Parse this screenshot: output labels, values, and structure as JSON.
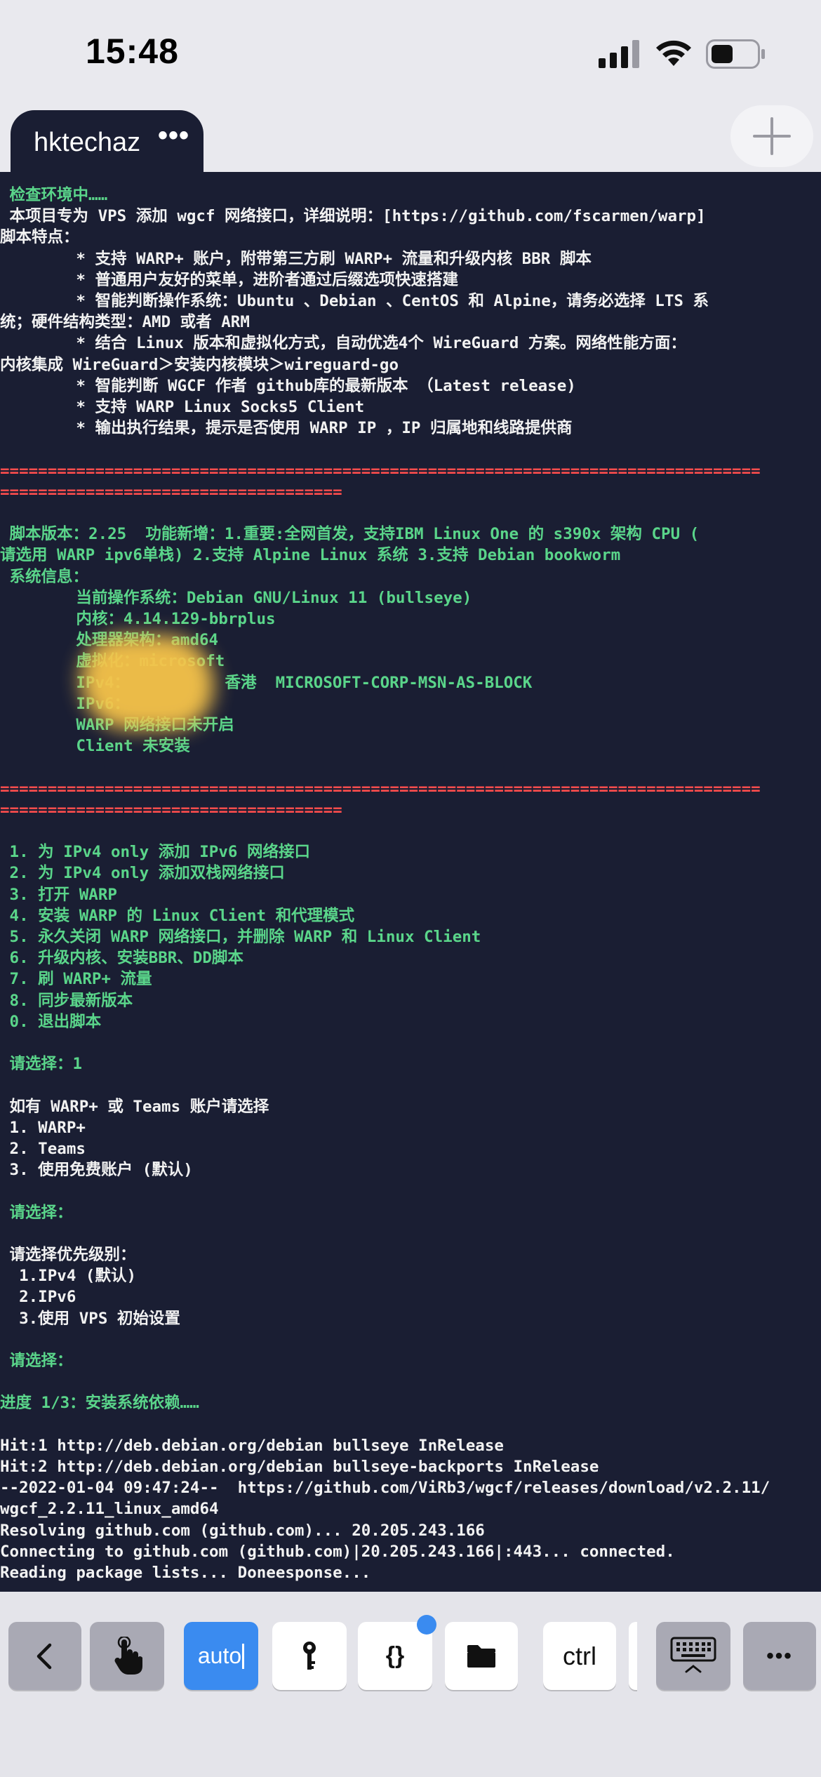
{
  "status_bar": {
    "time": "15:48",
    "icons": [
      "cellular-signal-icon",
      "wifi-icon",
      "battery-icon"
    ]
  },
  "tab": {
    "title": "hktechaz",
    "more_label": "•••",
    "add_tab_icon": "plus-icon"
  },
  "terminal": {
    "colors": {
      "background": "#1a1e33",
      "green": "#5ad58a",
      "white": "#f2f2f2",
      "red": "#ff4d4d"
    },
    "lines": [
      {
        "text": " 检查环境中……",
        "color": "g"
      },
      {
        "text": " 本项目专为 VPS 添加 wgcf 网络接口，详细说明：[https://github.com/fscarmen/warp]",
        "color": "w"
      },
      {
        "text": "脚本特点：",
        "color": "w"
      },
      {
        "text": "        * 支持 WARP+ 账户，附带第三方刷 WARP+ 流量和升级内核 BBR 脚本",
        "color": "w"
      },
      {
        "text": "        * 普通用户友好的菜单，进阶者通过后缀选项快速搭建",
        "color": "w"
      },
      {
        "text": "        * 智能判断操作系统：Ubuntu 、Debian 、CentOS 和 Alpine，请务必选择 LTS 系",
        "color": "w"
      },
      {
        "text": "统；硬件结构类型：AMD 或者 ARM",
        "color": "w"
      },
      {
        "text": "        * 结合 Linux 版本和虚拟化方式，自动优选4个 WireGuard 方案。网络性能方面：",
        "color": "w"
      },
      {
        "text": "内核集成 WireGuard＞安装内核模块＞wireguard-go",
        "color": "w"
      },
      {
        "text": "        * 智能判断 WGCF 作者 github库的最新版本 （Latest release)",
        "color": "w"
      },
      {
        "text": "        * 支持 WARP Linux Socks5 Client",
        "color": "w"
      },
      {
        "text": "        * 输出执行结果，提示是否使用 WARP IP ，IP 归属地和线路提供商",
        "color": "w"
      },
      {
        "text": "",
        "color": "w"
      },
      {
        "text": "================================================================================",
        "color": "r"
      },
      {
        "text": "====================================",
        "color": "r"
      },
      {
        "text": "",
        "color": "w"
      },
      {
        "text": " 脚本版本：2.25  功能新增：1.重要:全网首发，支持IBM Linux One 的 s390x 架构 CPU (",
        "color": "g"
      },
      {
        "text": "请选用 WARP ipv6单栈) 2.支持 Alpine Linux 系统 3.支持 Debian bookworm",
        "color": "g"
      },
      {
        "text": " 系统信息：",
        "color": "g"
      },
      {
        "text": "        当前操作系统：Debian GNU/Linux 11 (bullseye)",
        "color": "g"
      },
      {
        "text": "        内核：4.14.129-bbrplus",
        "color": "g"
      },
      {
        "text": "        处理器架构：amd64",
        "color": "g"
      },
      {
        "text": "        虚拟化：microsoft",
        "color": "g"
      },
      {
        "text": "        IPv4：          香港  MICROSOFT-CORP-MSN-AS-BLOCK",
        "color": "g"
      },
      {
        "text": "        IPv6：",
        "color": "g"
      },
      {
        "text": "        WARP 网络接口未开启",
        "color": "g"
      },
      {
        "text": "        Client 未安装",
        "color": "g"
      },
      {
        "text": "",
        "color": "w"
      },
      {
        "text": "================================================================================",
        "color": "r"
      },
      {
        "text": "====================================",
        "color": "r"
      },
      {
        "text": "",
        "color": "w"
      },
      {
        "text": " 1. 为 IPv4 only 添加 IPv6 网络接口",
        "color": "g"
      },
      {
        "text": " 2. 为 IPv4 only 添加双栈网络接口",
        "color": "g"
      },
      {
        "text": " 3. 打开 WARP",
        "color": "g"
      },
      {
        "text": " 4. 安装 WARP 的 Linux Client 和代理模式",
        "color": "g"
      },
      {
        "text": " 5. 永久关闭 WARP 网络接口，并删除 WARP 和 Linux Client",
        "color": "g"
      },
      {
        "text": " 6. 升级内核、安装BBR、DD脚本",
        "color": "g"
      },
      {
        "text": " 7. 刷 WARP+ 流量",
        "color": "g"
      },
      {
        "text": " 8. 同步最新版本",
        "color": "g"
      },
      {
        "text": " 0. 退出脚本",
        "color": "g"
      },
      {
        "text": "",
        "color": "w"
      },
      {
        "text": " 请选择：1",
        "color": "g"
      },
      {
        "text": "",
        "color": "w"
      },
      {
        "text": " 如有 WARP+ 或 Teams 账户请选择",
        "color": "w"
      },
      {
        "text": " 1. WARP+",
        "color": "w"
      },
      {
        "text": " 2. Teams",
        "color": "w"
      },
      {
        "text": " 3. 使用免费账户 (默认)",
        "color": "w"
      },
      {
        "text": "",
        "color": "w"
      },
      {
        "text": " 请选择：",
        "color": "g"
      },
      {
        "text": "",
        "color": "w"
      },
      {
        "text": " 请选择优先级别：",
        "color": "w"
      },
      {
        "text": "  1.IPv4 (默认)",
        "color": "w"
      },
      {
        "text": "  2.IPv6",
        "color": "w"
      },
      {
        "text": "  3.使用 VPS 初始设置",
        "color": "w"
      },
      {
        "text": "",
        "color": "w"
      },
      {
        "text": " 请选择：",
        "color": "g"
      },
      {
        "text": "",
        "color": "w"
      },
      {
        "text": "进度 1/3：安装系统依赖……",
        "color": "g"
      },
      {
        "text": "",
        "color": "w"
      },
      {
        "text": "Hit:1 http://deb.debian.org/debian bullseye InRelease",
        "color": "w"
      },
      {
        "text": "Hit:2 http://deb.debian.org/debian bullseye-backports InRelease",
        "color": "w"
      },
      {
        "text": "--2022-01-04 09:47:24--  https://github.com/ViRb3/wgcf/releases/download/v2.2.11/",
        "color": "w"
      },
      {
        "text": "wgcf_2.2.11_linux_amd64",
        "color": "w"
      },
      {
        "text": "Resolving github.com (github.com)... 20.205.243.166",
        "color": "w"
      },
      {
        "text": "Connecting to github.com (github.com)|20.205.243.166|:443... connected.",
        "color": "w"
      },
      {
        "text": "Reading package lists... Doneesponse...",
        "color": "w"
      }
    ]
  },
  "toolbar": {
    "keys": [
      {
        "name": "back-key",
        "label": "",
        "icon": "chevron-left-icon",
        "style": "gray"
      },
      {
        "name": "touch-mode-key",
        "label": "",
        "icon": "hand-pointer-icon",
        "style": "gray"
      },
      {
        "name": "auto-key",
        "label": "auto",
        "icon": "",
        "style": "blue"
      },
      {
        "name": "key-manager-key",
        "label": "",
        "icon": "key-icon",
        "style": "white"
      },
      {
        "name": "snippets-key",
        "label": "{}",
        "icon": "",
        "style": "white"
      },
      {
        "name": "files-key",
        "label": "",
        "icon": "folder-icon",
        "style": "white"
      },
      {
        "name": "ctrl-key",
        "label": "ctrl",
        "icon": "",
        "style": "white"
      },
      {
        "name": "hide-keyboard-key",
        "label": "",
        "icon": "keyboard-hide-icon",
        "style": "gray"
      },
      {
        "name": "more-key",
        "label": "•••",
        "icon": "",
        "style": "gray"
      }
    ]
  }
}
